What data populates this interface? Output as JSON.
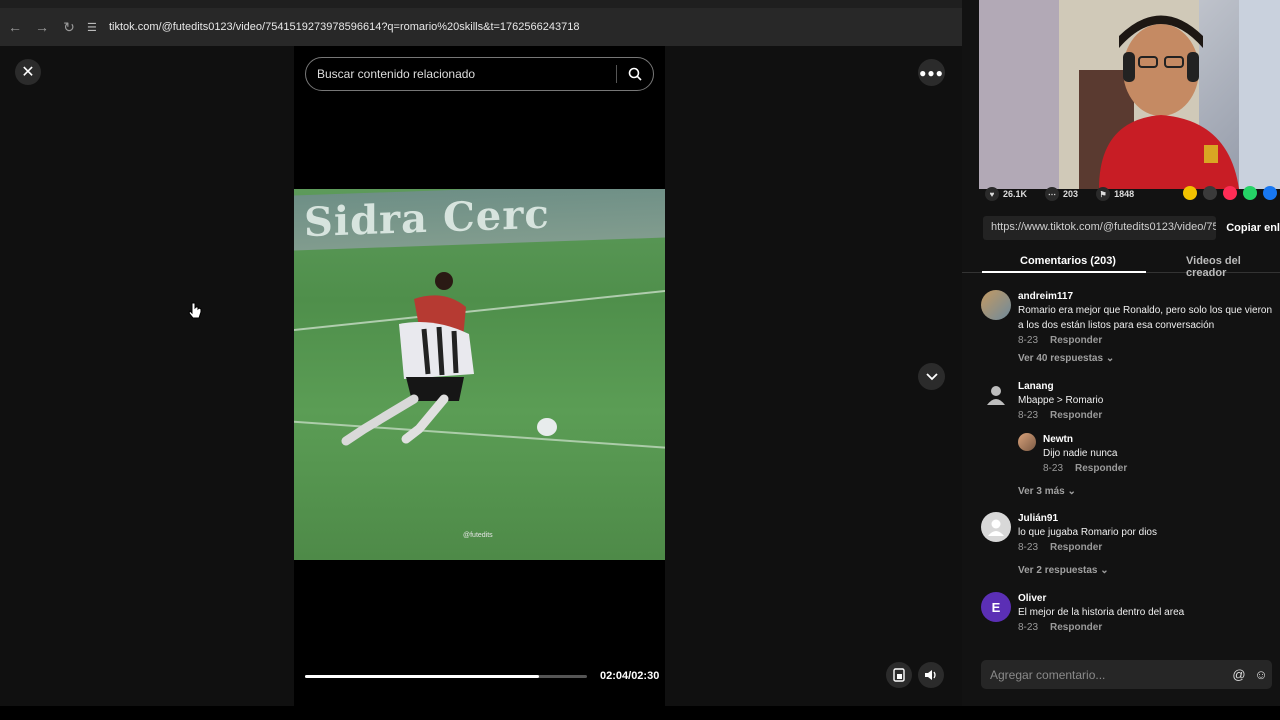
{
  "browser": {
    "url": "tiktok.com/@futedits0123/video/7541519273978596614?q=romario%20skills&t=1762566243718"
  },
  "search": {
    "placeholder": "Buscar contenido relacionado"
  },
  "video": {
    "banner_text": "Sidra Cerc",
    "watermark": "@futedits",
    "time": "02:04/02:30",
    "progress": 0.83
  },
  "stats": {
    "likes": "26.1K",
    "comments": "203",
    "saves": "1848"
  },
  "link": {
    "url": "https://www.tiktok.com/@futedits0123/video/75...",
    "copy_label": "Copiar enl"
  },
  "tabs": {
    "comments": "Comentarios (203)",
    "creator_videos": "Videos del creador"
  },
  "comments": [
    {
      "user": "andreim117",
      "text": "Romario era mejor que Ronaldo, pero solo los que vieron a los dos están listos para esa conversación",
      "date": "8-23",
      "reply": "Responder",
      "more": "Ver 40 respuestas"
    },
    {
      "user": "Lanang",
      "text": "Mbappe > Romario",
      "date": "8-23",
      "reply": "Responder"
    },
    {
      "user": "Newtn",
      "text": "Dijo nadie nunca",
      "date": "8-23",
      "reply": "Responder",
      "more": "Ver 3 más"
    },
    {
      "user": "Julián91",
      "text": "lo que jugaba Romario por dios",
      "date": "8-23",
      "reply": "Responder",
      "more": "Ver 2 respuestas"
    },
    {
      "user": "Oliver",
      "initial": "E",
      "text": "El mejor de la historia dentro del area",
      "date": "8-23",
      "reply": "Responder"
    }
  ],
  "comment_input": {
    "placeholder": "Agregar comentario..."
  }
}
